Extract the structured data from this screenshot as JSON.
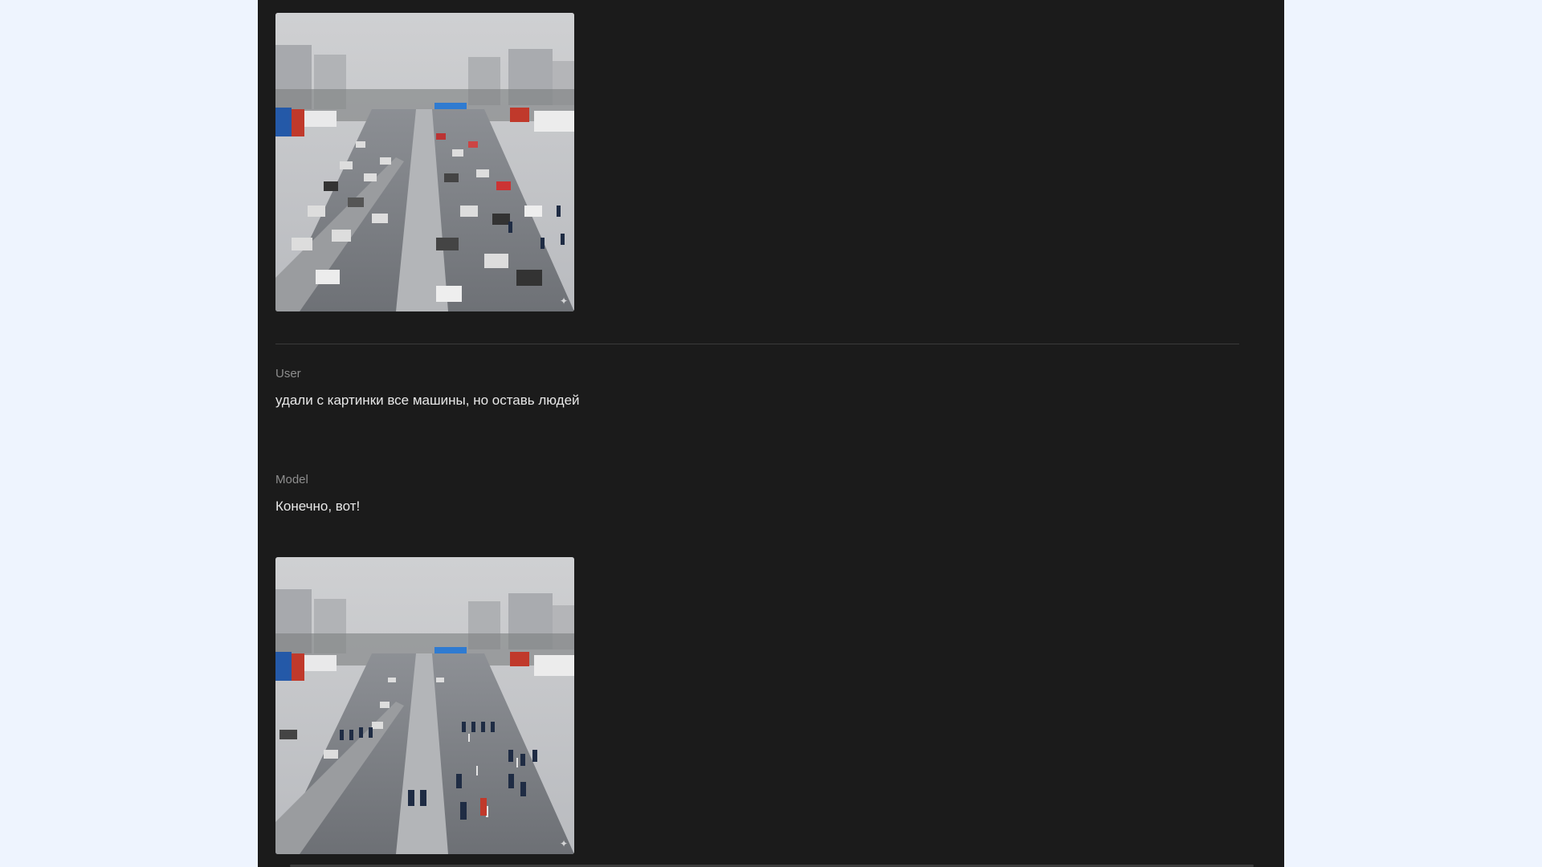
{
  "conversation": {
    "messages": [
      {
        "role": "User",
        "text": "удали с картинки все машины, но оставь людей"
      },
      {
        "role": "Model",
        "text": "Конечно, вот!"
      }
    ]
  },
  "images": {
    "original": {
      "description_icon": "traffic-jam-highway-photo"
    },
    "edited": {
      "description_icon": "empty-highway-with-pedestrians-photo"
    }
  },
  "colors": {
    "page_background": "#eef4fe",
    "panel_background": "#1b1b1b",
    "role_label": "#8e8e8e",
    "message_text": "#e8e8e8"
  }
}
